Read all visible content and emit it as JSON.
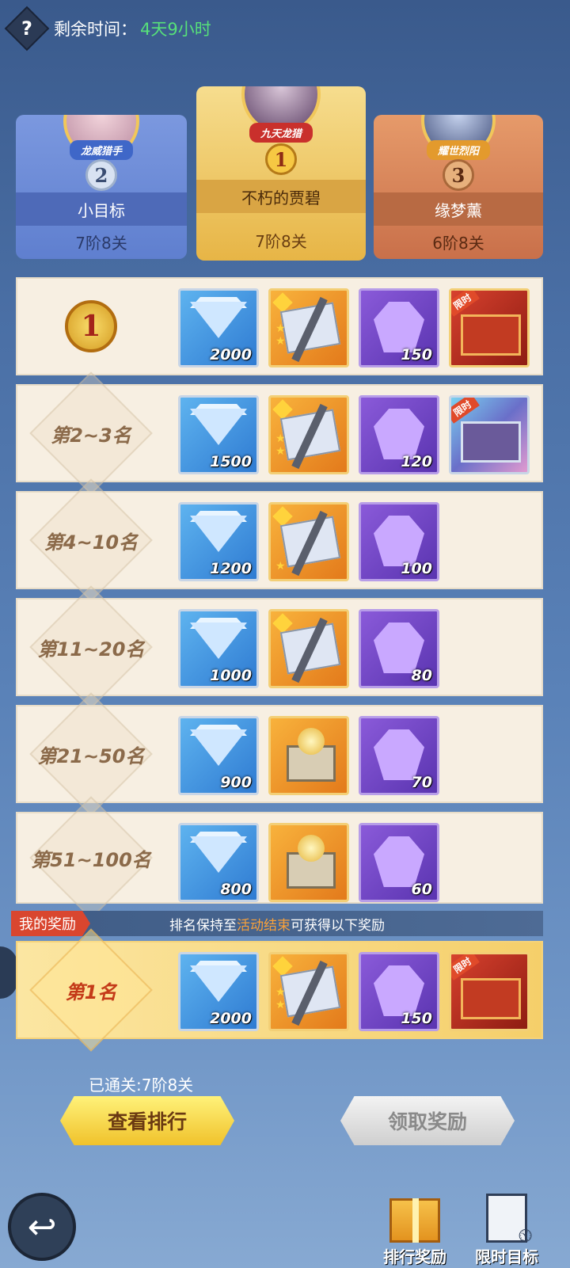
{
  "header": {
    "help_icon": "?",
    "timer_label": "剩余时间：",
    "timer_value": "4天9小时"
  },
  "podium": [
    {
      "rank": "2",
      "title": "龙威猎手",
      "name": "小目标",
      "level": "7阶8关"
    },
    {
      "rank": "1",
      "title": "九天龙猎",
      "name": "不朽的贾碧",
      "level": "7阶8关"
    },
    {
      "rank": "3",
      "title": "耀世烈阳",
      "name": "缘梦薰",
      "level": "6阶8关"
    }
  ],
  "tiers": [
    {
      "rank": "1",
      "items": [
        {
          "type": "diamond",
          "qty": "2000"
        },
        {
          "type": "scroll",
          "qty": ""
        },
        {
          "type": "purple-gem",
          "qty": "150"
        },
        {
          "type": "red-frame",
          "qty": "",
          "tag": "限时"
        }
      ]
    },
    {
      "rank": "第2~3名",
      "items": [
        {
          "type": "diamond",
          "qty": "1500"
        },
        {
          "type": "scroll",
          "qty": ""
        },
        {
          "type": "purple-gem",
          "qty": "120"
        },
        {
          "type": "blue-frame",
          "qty": "",
          "tag": "限时"
        }
      ]
    },
    {
      "rank": "第4~10名",
      "items": [
        {
          "type": "diamond",
          "qty": "1200"
        },
        {
          "type": "scroll",
          "qty": ""
        },
        {
          "type": "purple-gem",
          "qty": "100"
        }
      ]
    },
    {
      "rank": "第11~20名",
      "items": [
        {
          "type": "diamond",
          "qty": "1000"
        },
        {
          "type": "scroll",
          "qty": ""
        },
        {
          "type": "purple-gem",
          "qty": "80"
        }
      ]
    },
    {
      "rank": "第21~50名",
      "items": [
        {
          "type": "diamond",
          "qty": "900"
        },
        {
          "type": "chest",
          "qty": ""
        },
        {
          "type": "purple-gem",
          "qty": "70"
        }
      ]
    },
    {
      "rank": "第51~100名",
      "items": [
        {
          "type": "diamond",
          "qty": "800"
        },
        {
          "type": "chest",
          "qty": ""
        },
        {
          "type": "purple-gem",
          "qty": "60"
        }
      ]
    }
  ],
  "my_reward": {
    "tag": "我的奖励",
    "note_prefix": "排名保持至",
    "note_highlight": "活动结束",
    "note_suffix": "可获得以下奖励",
    "rank": "第1名",
    "items": [
      {
        "type": "diamond",
        "qty": "2000"
      },
      {
        "type": "scroll",
        "qty": ""
      },
      {
        "type": "purple-gem",
        "qty": "150"
      },
      {
        "type": "red-frame",
        "qty": "",
        "tag": "限时"
      }
    ]
  },
  "progress": "已通关:7阶8关",
  "buttons": {
    "view_ranking": "查看排行",
    "claim_reward": "领取奖励"
  },
  "nav": {
    "back_icon": "↩",
    "ranking_reward": "排行奖励",
    "limited_goal": "限时目标"
  },
  "colors": {
    "timer_green": "#57e07a",
    "highlight_orange": "#f9a13a",
    "tag_red": "#d9462f"
  }
}
